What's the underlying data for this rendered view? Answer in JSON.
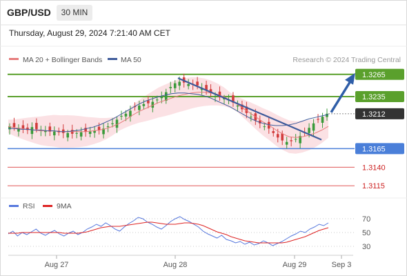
{
  "header": {
    "symbol": "GBP/USD",
    "timeframe": "30 MIN",
    "timestamp": "Thursday, August 29, 2024 7:21:40 AM CET"
  },
  "credit": "Research © 2024 Trading Central",
  "colors": {
    "candle_up": "#3a9a3a",
    "candle_down": "#d23c3c",
    "ma20": "#e67a7a",
    "bollinger_fill": "#fadadd",
    "ma50": "#3d5a9a",
    "resistance": "#5aa02c",
    "pivot": "#4a7fd9",
    "support": "#e05555",
    "current": "#333333",
    "rsi": "#5577dd",
    "rsi_ma": "#dd2222",
    "arrow": "#2f5ea8"
  },
  "chart_data": [
    {
      "type": "candlestick",
      "title": "GBP/USD",
      "timeframe": "30 MIN",
      "legend": [
        {
          "label": "MA 20 + Bollinger Bands",
          "color": "#e67a7a"
        },
        {
          "label": "MA 50",
          "color": "#3d5a9a"
        }
      ],
      "x_ticks": [
        "Aug 27",
        "Aug 28",
        "Aug 29",
        "Sep 3"
      ],
      "y_range": [
        1.3105,
        1.3275
      ],
      "levels": [
        {
          "value": 1.3265,
          "label": "1.3265",
          "kind": "resistance"
        },
        {
          "value": 1.3235,
          "label": "1.3235",
          "kind": "resistance"
        },
        {
          "value": 1.3212,
          "label": "1.3212",
          "kind": "current"
        },
        {
          "value": 1.3165,
          "label": "1.3165",
          "kind": "pivot"
        },
        {
          "value": 1.314,
          "label": "1.3140",
          "kind": "support"
        },
        {
          "value": 1.3115,
          "label": "1.3115",
          "kind": "support"
        }
      ],
      "close_series": [
        1.3195,
        1.3194,
        1.3193,
        1.3192,
        1.319,
        1.3194,
        1.3191,
        1.319,
        1.3189,
        1.3188,
        1.3188,
        1.3187,
        1.3186,
        1.3186,
        1.3185,
        1.3186,
        1.3187,
        1.3188,
        1.3188,
        1.3189,
        1.319,
        1.3192,
        1.3195,
        1.3199,
        1.3204,
        1.3209,
        1.3212,
        1.3216,
        1.3221,
        1.3223,
        1.3225,
        1.3226,
        1.3228,
        1.3231,
        1.3235,
        1.3241,
        1.3248,
        1.3253,
        1.3255,
        1.3254,
        1.3252,
        1.3251,
        1.325,
        1.3247,
        1.3244,
        1.324,
        1.3236,
        1.3234,
        1.3233,
        1.3231,
        1.3227,
        1.3223,
        1.3218,
        1.3213,
        1.3208,
        1.3203,
        1.3199,
        1.3195,
        1.3192,
        1.3186,
        1.318,
        1.3176,
        1.3174,
        1.3175,
        1.3178,
        1.3182,
        1.3187,
        1.3193,
        1.3199,
        1.3204,
        1.3208,
        1.3212
      ],
      "ma20_series": [
        1.3195,
        1.3193,
        1.3192,
        1.3191,
        1.319,
        1.3189,
        1.3189,
        1.3189,
        1.3188,
        1.3188,
        1.3188,
        1.3188,
        1.3188,
        1.3189,
        1.319,
        1.3192,
        1.3195,
        1.3199,
        1.3204,
        1.321,
        1.3215,
        1.3219,
        1.3223,
        1.3227,
        1.323,
        1.3233,
        1.3236,
        1.3238,
        1.324,
        1.3241,
        1.3241,
        1.324,
        1.3238,
        1.3235,
        1.323,
        1.3225,
        1.3219,
        1.3213,
        1.3207,
        1.3201,
        1.3196,
        1.319,
        1.3185,
        1.3181,
        1.318,
        1.3181,
        1.3183,
        1.3186,
        1.319,
        1.3195
      ],
      "ma50_series": [
        1.3192,
        1.3192,
        1.3191,
        1.3191,
        1.319,
        1.319,
        1.3189,
        1.3189,
        1.3188,
        1.3188,
        1.3189,
        1.319,
        1.3192,
        1.3194,
        1.3197,
        1.3201,
        1.3205,
        1.321,
        1.3215,
        1.322,
        1.3225,
        1.3229,
        1.3232,
        1.3235,
        1.3237,
        1.3239,
        1.324,
        1.324,
        1.3239,
        1.3238,
        1.3236,
        1.3233,
        1.3229,
        1.3225,
        1.3221,
        1.3216,
        1.3211,
        1.3206,
        1.3202,
        1.3199,
        1.3197,
        1.3196,
        1.3196,
        1.3197,
        1.3199,
        1.3202,
        1.3205,
        1.3207,
        1.3209,
        1.3211
      ],
      "trendline": [
        {
          "x": "Aug 28",
          "value": 1.326
        },
        {
          "x": "Aug 29",
          "value": 1.3177
        }
      ],
      "forecast_arrow": {
        "from": 1.3212,
        "to": 1.3265
      }
    },
    {
      "type": "line",
      "legend": [
        {
          "label": "RSI",
          "color": "#5577dd"
        },
        {
          "label": "9MA",
          "color": "#dd2222"
        }
      ],
      "y_ticks": [
        "70",
        "50",
        "30"
      ],
      "y_range": [
        20,
        80
      ],
      "overbought": 70,
      "oversold": 30,
      "rsi_series": [
        48,
        52,
        45,
        50,
        47,
        51,
        55,
        49,
        46,
        50,
        53,
        48,
        45,
        49,
        52,
        47,
        50,
        55,
        58,
        62,
        59,
        64,
        60,
        55,
        52,
        58,
        63,
        67,
        72,
        70,
        65,
        62,
        58,
        55,
        60,
        66,
        70,
        73,
        69,
        66,
        62,
        58,
        52,
        48,
        45,
        42,
        46,
        40,
        38,
        35,
        37,
        33,
        36,
        32,
        34,
        38,
        35,
        31,
        34,
        37,
        41,
        45,
        48,
        52,
        50,
        55,
        58,
        62,
        60,
        64
      ],
      "ma_series": [
        49,
        49,
        49,
        50,
        50,
        50,
        50,
        50,
        50,
        50,
        50,
        50,
        49,
        49,
        49,
        49,
        50,
        51,
        53,
        55,
        57,
        58,
        59,
        59,
        59,
        60,
        61,
        62,
        63,
        64,
        65,
        65,
        64,
        63,
        62,
        62,
        62,
        63,
        64,
        64,
        63,
        62,
        60,
        57,
        54,
        51,
        49,
        47,
        44,
        42,
        40,
        38,
        37,
        36,
        35,
        35,
        35,
        35,
        35,
        35,
        36,
        38,
        40,
        42,
        44,
        47,
        50,
        53,
        55,
        57
      ]
    }
  ]
}
